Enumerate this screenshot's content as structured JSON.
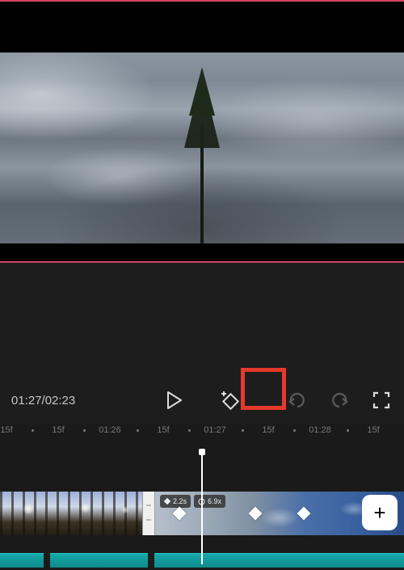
{
  "time": {
    "current": "01:27",
    "total": "02:23",
    "display": "01:27/02:23"
  },
  "ruler": {
    "marks": [
      "15f",
      "·",
      "15f",
      "·",
      "01:26",
      "·",
      "15f",
      "·",
      "01:27",
      "·",
      "15f",
      "·",
      "01:28",
      "·",
      "15f"
    ],
    "positions": [
      -12,
      20,
      52,
      84,
      116,
      150,
      182,
      214,
      246,
      280,
      312,
      344,
      376,
      410,
      442
    ]
  },
  "clip": {
    "duration_badge": "2.2s",
    "speed_badge": "6.9x"
  },
  "controls": {
    "play_label": "Play",
    "keyframe_label": "Add Keyframe",
    "undo_label": "Undo",
    "redo_label": "Redo",
    "fullscreen_label": "Fullscreen",
    "add_label": "+"
  },
  "colors": {
    "highlight": "#e5392b",
    "accent_pink": "#d64561",
    "teal": "#16a9ab"
  },
  "keyframes": [
    24,
    118,
    178
  ]
}
